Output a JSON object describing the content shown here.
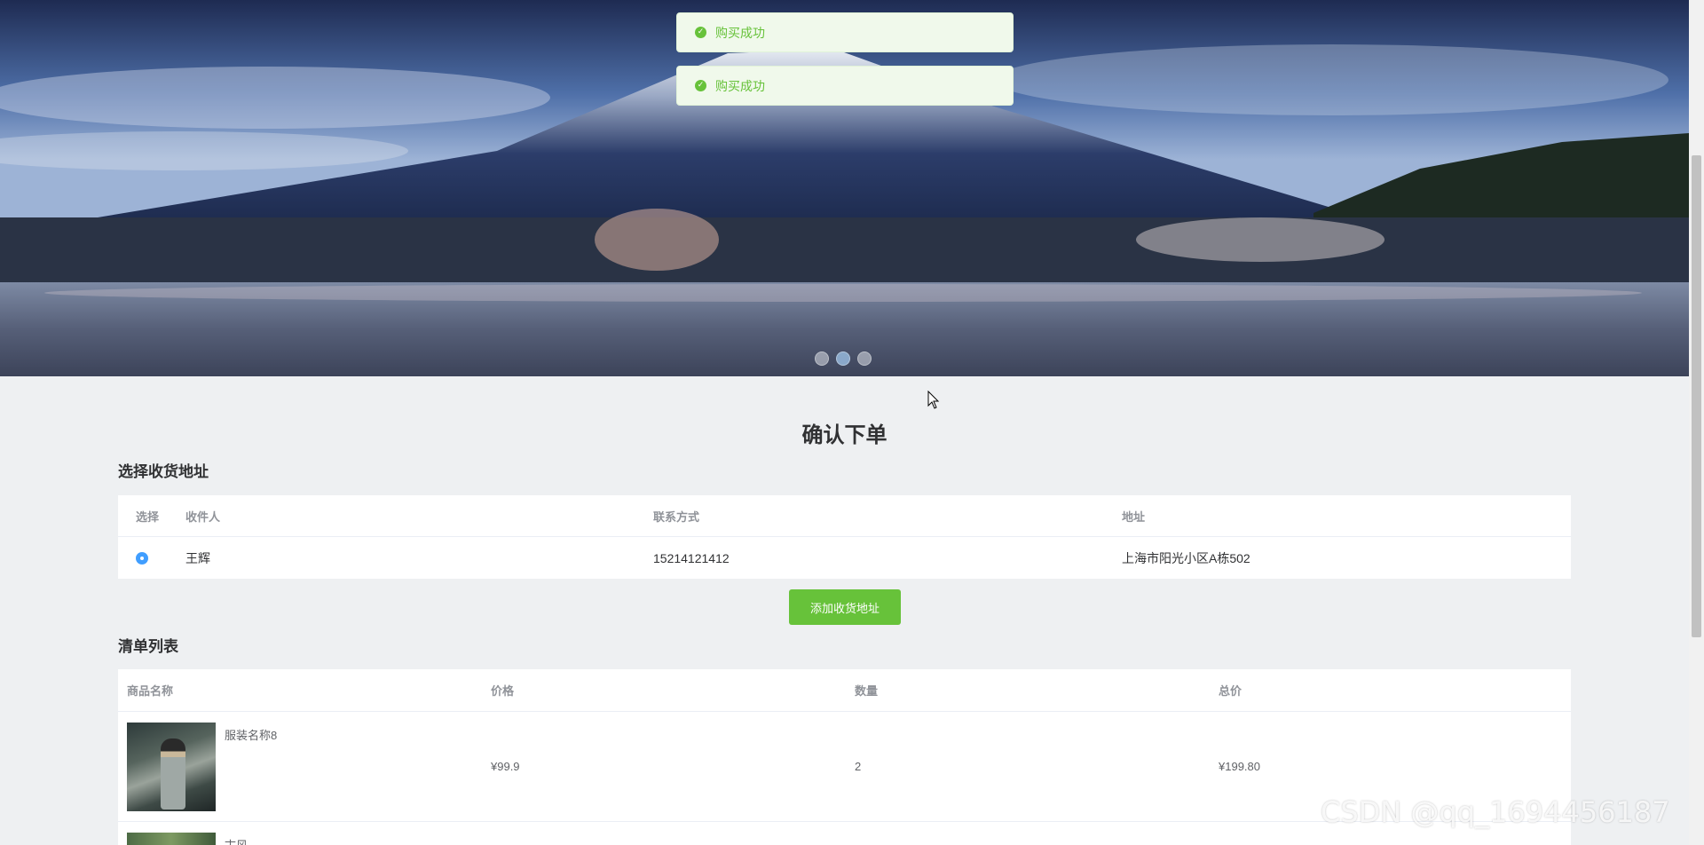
{
  "banner": {
    "slides": [
      "slide-1",
      "slide-2",
      "slide-3"
    ],
    "active_index": 1
  },
  "toasts": [
    {
      "text": "购买成功",
      "type": "success"
    },
    {
      "text": "购买成功",
      "type": "success"
    }
  ],
  "page": {
    "title": "确认下单"
  },
  "address_section": {
    "title": "选择收货地址",
    "columns": [
      "选择",
      "收件人",
      "联系方式",
      "地址"
    ],
    "rows": [
      {
        "selected": true,
        "name": "王辉",
        "phone": "15214121412",
        "address": "上海市阳光小区A栋502"
      }
    ],
    "add_button": "添加收货地址"
  },
  "order_section": {
    "title": "清单列表",
    "columns": [
      "商品名称",
      "价格",
      "数量",
      "总价"
    ],
    "items": [
      {
        "name": "服装名称8",
        "price": "¥99.9",
        "quantity": "2",
        "total": "¥199.80"
      },
      {
        "name": "古风",
        "price": "",
        "quantity": "",
        "total": ""
      }
    ]
  },
  "colors": {
    "accent": "#409eff",
    "success": "#67c23a",
    "toast_bg": "#f0f9eb"
  },
  "watermark": "CSDN @qq_1694456187"
}
